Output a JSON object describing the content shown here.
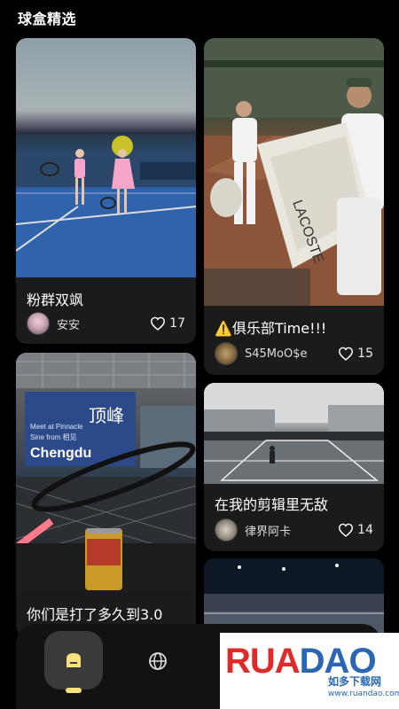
{
  "header": {
    "title": "球盒精选"
  },
  "cards": [
    {
      "title": "粉群双飒",
      "author": "安安",
      "likes": "17"
    },
    {
      "title": "⚠️俱乐部Time!!!",
      "author": "S45MoO$e",
      "likes": "15"
    },
    {
      "title": "你们是打了多久到3.0",
      "banner_lines": [
        "Meet at Pinnacle",
        "Sine from 相见",
        "Chengdu"
      ],
      "calligraphy": "顶峰"
    },
    {
      "title": "在我的剪辑里无敌",
      "author": "律界阿卡",
      "likes": "14"
    },
    {
      "title": "",
      "author": "",
      "likes": ""
    }
  ],
  "watermark": {
    "logo_text": "RUANDAO",
    "subtitle": "如多下载网",
    "url": "www.ruandao.com"
  },
  "colors": {
    "background": "#000000",
    "card_bg": "#1b1b1b",
    "nav_bg": "#121212",
    "nav_active_bg": "#3a3a3a",
    "accent": "#f7e27a",
    "watermark_red": "#e02a2a",
    "watermark_blue": "#2a66b3"
  },
  "icons": {
    "like": "heart-outline-icon",
    "home": "home-icon",
    "explore": "globe-icon"
  }
}
